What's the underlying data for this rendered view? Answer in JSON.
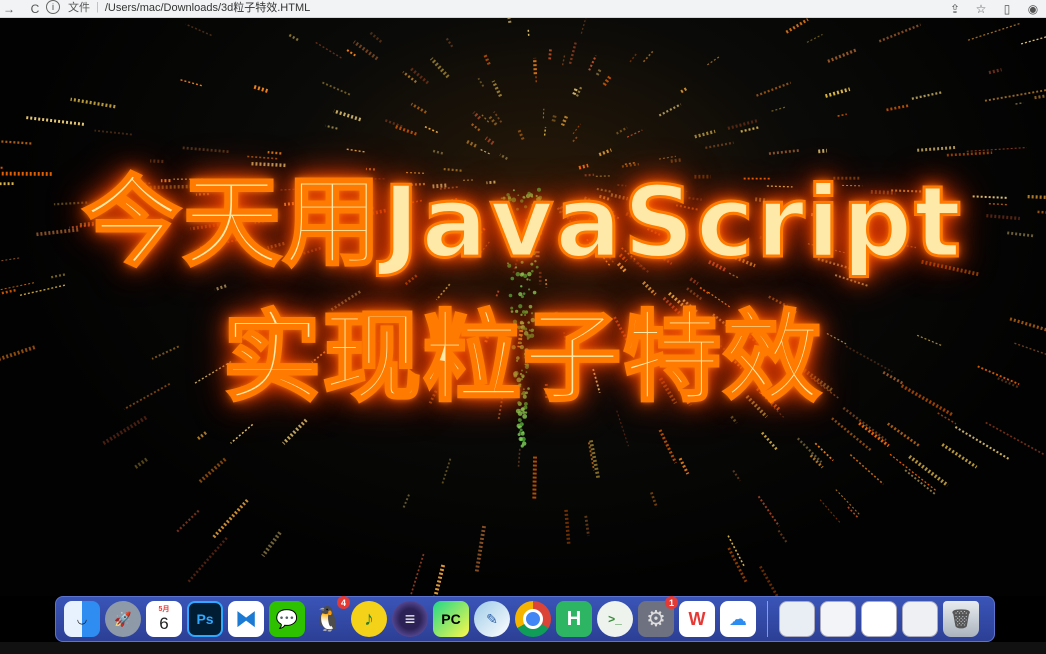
{
  "browser": {
    "file_label": "文件",
    "url": "/Users/mac/Downloads/3d粒子特效.HTML",
    "buttons": {
      "back": "→",
      "reload": "C",
      "share": "⇪",
      "bookmark": "☆",
      "sidebar": "▯",
      "profile": "◉"
    }
  },
  "headline": {
    "line1": "今天用JavaScript",
    "line2": "实现粒子特效"
  },
  "dock": {
    "calendar": {
      "month": "5月",
      "day": "6"
    },
    "photoshop_label": "Ps",
    "pycharm_label": "PC",
    "hbuilder_label": "H",
    "terminal_label": ">_",
    "wps_label": "W",
    "qq_badge": "4",
    "settings_badge": "1"
  },
  "colors": {
    "glow": "#ff6a00",
    "dock": "#2f45a0"
  }
}
